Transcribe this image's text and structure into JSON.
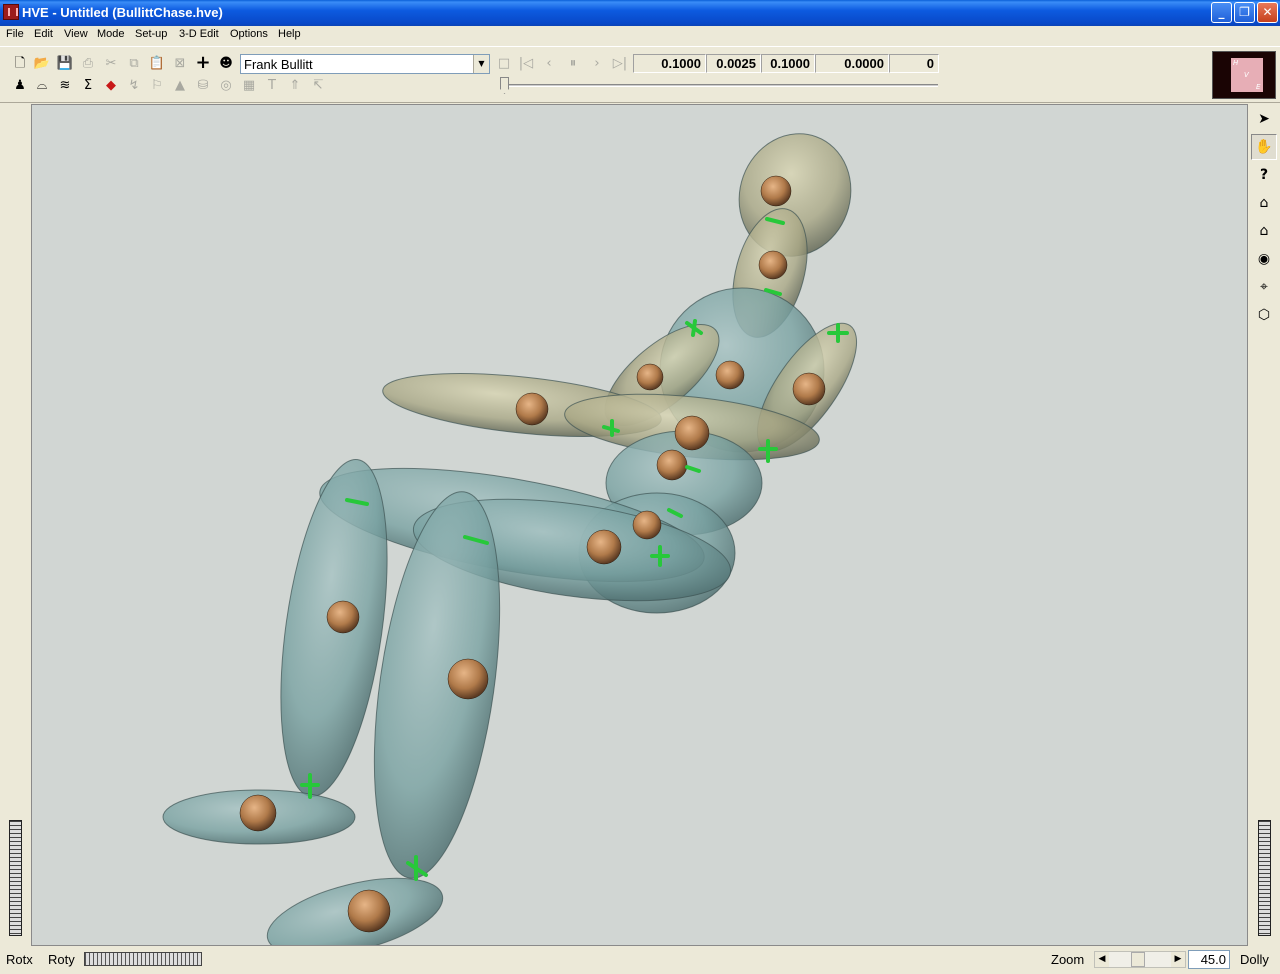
{
  "window": {
    "title": "HVE - Untitled (BullittChase.hve)",
    "minimize": "_",
    "restore": "❐",
    "close": "✕"
  },
  "menu": [
    "File",
    "Edit",
    "View",
    "Mode",
    "Set-up",
    "3-D Edit",
    "Options",
    "Help"
  ],
  "toolbar": {
    "selected_object": "Frank Bullitt",
    "fields": [
      "0.1000",
      "0.0025",
      "0.1000",
      "0.0000",
      "0"
    ],
    "icons_row1": [
      "new-file-icon",
      "open-file-icon",
      "save-icon",
      "print-icon",
      "cut-icon",
      "copy-icon",
      "paste-icon",
      "delete-icon",
      "add-icon",
      "human-model-icon"
    ],
    "icons_row2": [
      "humans-icon",
      "environment-icon",
      "terrain-icon",
      "sum-icon",
      "collision-icon",
      "path-icon",
      "flag-icon",
      "cone-icon",
      "barrel-icon",
      "tire-icon",
      "wall-icon",
      "text-icon",
      "pin-icon",
      "arrow-icon"
    ],
    "playback_icons": [
      "stop-icon",
      "rewind-start-icon",
      "step-back-icon",
      "pause-icon",
      "step-forward-icon",
      "fast-forward-end-icon"
    ]
  },
  "logo": {
    "letters": [
      "H",
      "V",
      "E"
    ]
  },
  "right_tools": [
    "select-arrow-icon",
    "hand-pan-icon",
    "help-icon",
    "home-icon",
    "home-set-icon",
    "eye-view-icon",
    "target-icon",
    "cube-view-icon"
  ],
  "statusbar": {
    "rotx": "Rotx",
    "roty": "Roty",
    "zoom": "Zoom",
    "zoom_value": "45.0",
    "dolly": "Dolly"
  },
  "colors": {
    "viewport_bg": "#d1d6d3",
    "body_segment": "#6e9596",
    "joint": "#b07a4a",
    "marker": "#27c83a"
  }
}
